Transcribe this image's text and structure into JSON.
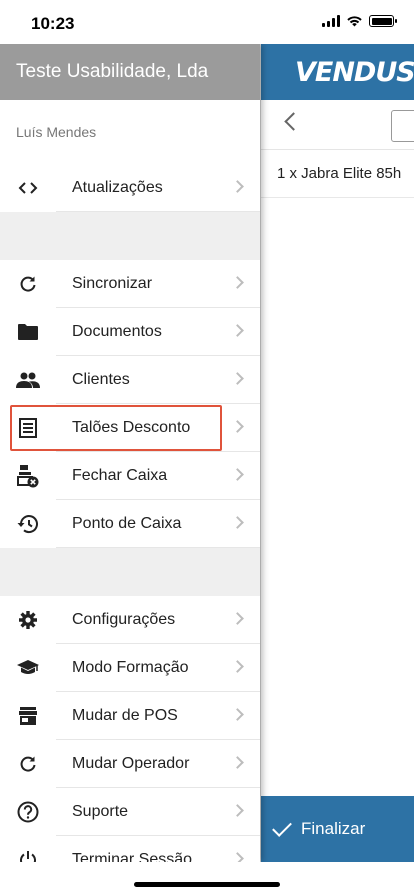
{
  "status_bar": {
    "time": "10:23"
  },
  "app": {
    "logo": "VENDUS",
    "order_line": "1 x Jabra Elite 85h",
    "finalize_label": "Finalizar"
  },
  "drawer": {
    "company": "Teste Usabilidade, Lda",
    "operator": "Luís Mendes",
    "items": [
      {
        "label": "Atualizações",
        "icon": "code-icon"
      },
      {
        "label": "Sincronizar",
        "icon": "refresh-icon"
      },
      {
        "label": "Documentos",
        "icon": "folder-icon"
      },
      {
        "label": "Clientes",
        "icon": "people-icon"
      },
      {
        "label": "Talões Desconto",
        "icon": "receipt-icon"
      },
      {
        "label": "Fechar Caixa",
        "icon": "close-register-icon"
      },
      {
        "label": "Ponto de Caixa",
        "icon": "history-icon"
      },
      {
        "label": "Configurações",
        "icon": "gear-icon"
      },
      {
        "label": "Modo Formação",
        "icon": "graduation-cap-icon"
      },
      {
        "label": "Mudar de POS",
        "icon": "store-icon"
      },
      {
        "label": "Mudar Operador",
        "icon": "refresh-icon"
      },
      {
        "label": "Suporte",
        "icon": "help-icon"
      },
      {
        "label": "Terminar Sessão",
        "icon": "power-icon"
      }
    ]
  },
  "colors": {
    "header_blue": "#2d72a5",
    "drawer_header": "#9b9b9b",
    "highlight": "#e0533b"
  }
}
